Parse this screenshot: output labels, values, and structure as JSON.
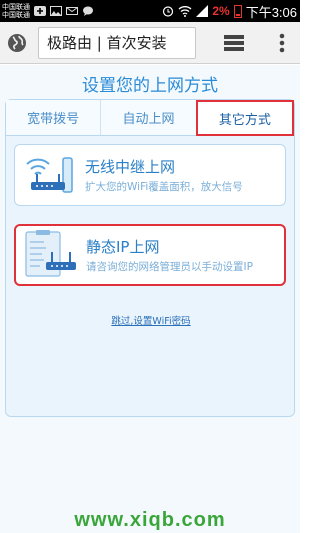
{
  "status_bar": {
    "carrier_1": "中国联通",
    "carrier_2": "中国联通",
    "battery_percent": "2%",
    "time": "下午3:06",
    "icons": [
      "plus-icon",
      "image-icon",
      "mail-icon",
      "chat-icon",
      "alarm-icon",
      "wifi-icon",
      "signal-icon",
      "battery-icon"
    ]
  },
  "toolbar": {
    "url_text": "极路由 | 首次安装",
    "icons": [
      "globe-icon",
      "tabs-icon",
      "more-icon"
    ]
  },
  "page": {
    "title": "设置您的上网方式",
    "tabs": [
      {
        "label": "宽带拨号",
        "active": false
      },
      {
        "label": "自动上网",
        "active": false
      },
      {
        "label": "其它方式",
        "active": true
      }
    ],
    "options": [
      {
        "title": "无线中继上网",
        "description": "扩大您的WiFi覆盖面积，放大信号",
        "icon": "router-repeater-icon"
      },
      {
        "title": "静态IP上网",
        "description": "请咨询您的网络管理员以手动设置IP",
        "icon": "router-static-ip-icon"
      }
    ],
    "skip_link": "跳过,设置WiFi密码"
  },
  "watermark": "www.xiqb.com",
  "colors": {
    "accent": "#2a8bd6",
    "highlight_border": "#e0303a",
    "watermark": "#3aa63a"
  }
}
